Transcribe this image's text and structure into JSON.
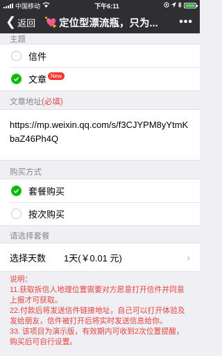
{
  "status": {
    "carrier": "中国移动",
    "time": "下午6:11"
  },
  "nav": {
    "back_label": "返回",
    "title": "定位型漂流瓶，只为...",
    "title_emoji": "💘",
    "more": "•••"
  },
  "topic": {
    "label": "主题",
    "options": [
      {
        "text": "信件",
        "selected": false
      },
      {
        "text": "文章",
        "selected": true,
        "badge": "New"
      }
    ]
  },
  "article": {
    "label": "文章地址",
    "required": "(必填)",
    "url": "https://mp.weixin.qq.com/s/f3CJYPM8yYtmKbaZ46Ph4Q"
  },
  "purchase": {
    "label": "购买方式",
    "options": [
      {
        "text": "套餐购买",
        "selected": true
      },
      {
        "text": "按次购买",
        "selected": false
      }
    ]
  },
  "package": {
    "label": "请选择套餐",
    "select_label": "选择天数",
    "select_value": "1天(￥0.01 元)"
  },
  "notes": {
    "title": "说明：",
    "lines": [
      "11.获取拆信人地理位置需要对方愿意打开信件并同意上报才可获取。",
      "22.付款后将发送信件链接地址，自己可以打开体验及发给朋友，信件被打开后将实时发送信息给你。",
      "33. 该项目为演示版，有效期内可收到2次位置提醒，购买后可自行设置。"
    ]
  }
}
